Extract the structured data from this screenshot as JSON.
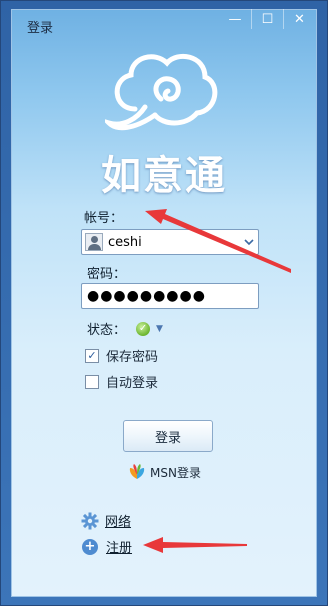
{
  "window": {
    "title": "登录"
  },
  "titlebar": {
    "minimize_glyph": "—",
    "maximize_glyph": "☐",
    "close_glyph": "✕"
  },
  "app": {
    "name": "如意通"
  },
  "account": {
    "label": "帐号：",
    "value": "ceshi"
  },
  "password": {
    "label": "密码：",
    "masked_value": "●●●●●●●●●"
  },
  "status": {
    "label": "状态：",
    "icon": "online-status-icon"
  },
  "options": {
    "save_password": "保存密码",
    "save_password_checked": true,
    "auto_login": "自动登录",
    "auto_login_checked": false
  },
  "buttons": {
    "login": "登录"
  },
  "msn": {
    "label": "MSN登录"
  },
  "links": {
    "network": "网络",
    "register": "注册"
  },
  "colors": {
    "accent": "#3c75b9",
    "arrow": "#e8383a"
  }
}
